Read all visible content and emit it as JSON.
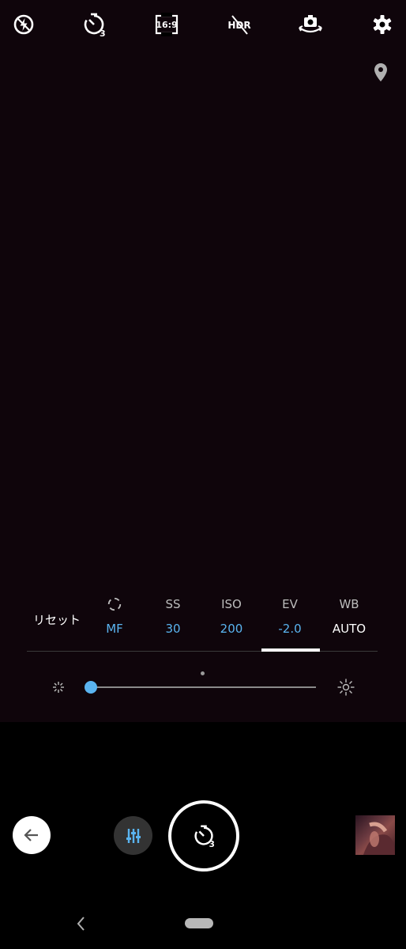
{
  "top_bar": {
    "icons": [
      "flash-off-icon",
      "self-timer-3s-icon",
      "aspect-ratio-icon",
      "hdr-off-icon",
      "switch-camera-icon",
      "settings-gear-icon"
    ],
    "aspect_ratio_label": "16:9",
    "hdr_label": "HDR",
    "timer_badge": "3"
  },
  "manual_controls": {
    "reset_label": "リセット",
    "params": [
      {
        "label": "",
        "value": "MF",
        "icon": "focus-icon"
      },
      {
        "label": "SS",
        "value": "30"
      },
      {
        "label": "ISO",
        "value": "200"
      },
      {
        "label": "EV",
        "value": "-2.0"
      },
      {
        "label": "WB",
        "value": "AUTO"
      }
    ],
    "selected": "EV"
  },
  "slider": {
    "level": 0.0
  },
  "bottom": {
    "shutter_timer_badge": "3",
    "icons": [
      "back-arrow-icon",
      "sliders-icon",
      "self-timer-icon",
      "gallery-thumbnail"
    ]
  },
  "colors": {
    "accent": "#5ab4f0",
    "viewfinder": "#0f050b",
    "background": "#000000"
  }
}
